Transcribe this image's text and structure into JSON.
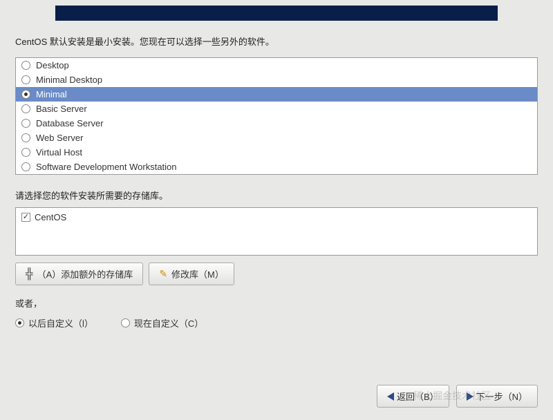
{
  "description": "CentOS 默认安装是最小安装。您现在可以选择一些另外的软件。",
  "options": [
    {
      "label": "Desktop",
      "selected": false
    },
    {
      "label": "Minimal Desktop",
      "selected": false
    },
    {
      "label": "Minimal",
      "selected": true
    },
    {
      "label": "Basic Server",
      "selected": false
    },
    {
      "label": "Database Server",
      "selected": false
    },
    {
      "label": "Web Server",
      "selected": false
    },
    {
      "label": "Virtual Host",
      "selected": false
    },
    {
      "label": "Software Development Workstation",
      "selected": false
    }
  ],
  "repo_section": {
    "label": "请选择您的软件安装所需要的存储库。",
    "items": [
      {
        "label": "CentOS",
        "checked": true
      }
    ]
  },
  "buttons": {
    "add_repo": "（A）添加额外的存储库",
    "modify_repo": "修改库（M）"
  },
  "or_label": "或者，",
  "customize": {
    "later": "以后自定义（l）",
    "now": "现在自定义（C）",
    "selected": "later"
  },
  "nav": {
    "back": "返回（B）",
    "next": "下一步（N）"
  },
  "watermark": "@ 稀土掘金技术社区"
}
